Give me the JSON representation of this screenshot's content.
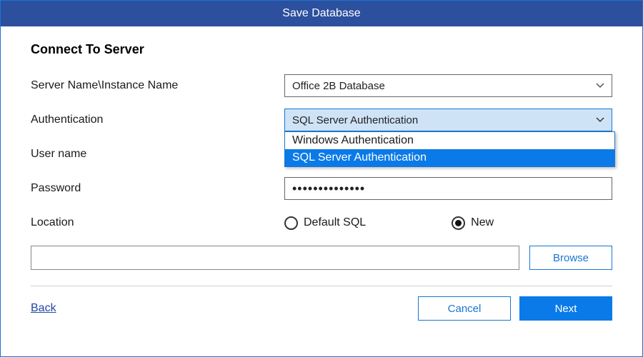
{
  "titlebar": {
    "text": "Save Database"
  },
  "section": {
    "title": "Connect To Server"
  },
  "labels": {
    "server": "Server Name\\Instance Name",
    "auth": "Authentication",
    "user": "User name",
    "password": "Password",
    "location": "Location"
  },
  "fields": {
    "server": {
      "value": "Office 2B Database"
    },
    "auth": {
      "value": "SQL Server Authentication",
      "options": [
        "Windows Authentication",
        "SQL Server Authentication"
      ],
      "selected_index": 1,
      "open": true
    },
    "user": {
      "value": ""
    },
    "password": {
      "masked": "••••••••••••••"
    },
    "location": {
      "options": [
        {
          "label": "Default SQL",
          "checked": false
        },
        {
          "label": "New",
          "checked": true
        }
      ],
      "path": ""
    }
  },
  "buttons": {
    "browse": "Browse",
    "back": "Back",
    "cancel": "Cancel",
    "next": "Next"
  }
}
